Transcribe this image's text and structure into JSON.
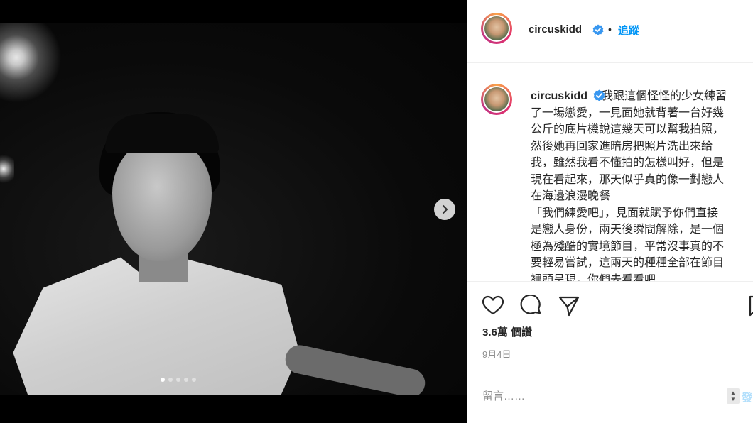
{
  "post": {
    "username": "circuskidd",
    "follow_separator": "•",
    "follow_label": "追蹤",
    "caption_username": "circuskidd",
    "caption_text": "我跟這個怪怪的少女練習\n了一場戀愛，一見面她就背著一台好幾\n公斤的底片機說這幾天可以幫我拍照，\n然後她再回家進暗房把照片洗出來給\n我，雖然我看不懂拍的怎樣叫好，但是\n現在看起來，那天似乎真的像一對戀人\n在海邊浪漫晚餐\n「我們練愛吧」，見面就賦予你們直接\n是戀人身份，兩天後瞬間解除，是一個\n極為殘酷的實境節目，平常沒事真的不\n要輕易嘗試，這兩天的種種全部在節目\n裡頭呈現，你們去看看吧",
    "views": "3.6萬 個讚",
    "date": "9月4日",
    "comment_placeholder": "留言……",
    "post_label": "發",
    "carousel": {
      "count": 5,
      "active_index": 0
    }
  },
  "icons": {
    "verified": "verified-badge-icon",
    "like": "heart-icon",
    "comment": "comment-bubble-icon",
    "share": "paper-plane-icon",
    "save": "bookmark-icon",
    "next": "chevron-right-icon"
  },
  "colors": {
    "link_blue": "#0095f6",
    "verified_blue": "#3897f0",
    "text": "#262626",
    "muted": "#8e8e8e"
  }
}
